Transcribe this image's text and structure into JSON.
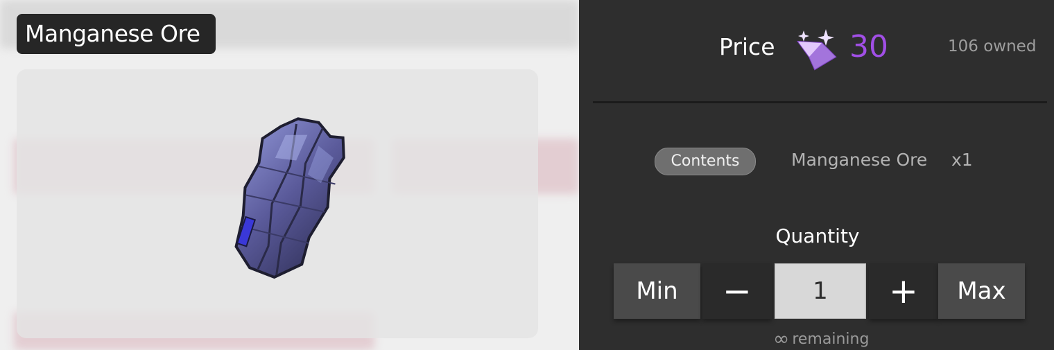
{
  "item": {
    "name": "Manganese Ore"
  },
  "price": {
    "label": "Price",
    "value": "30",
    "currency_icon": "purple-gem-icon",
    "currency_color": "#a14fe6",
    "owned": "106 owned"
  },
  "contents": {
    "tab_label": "Contents",
    "item_name": "Manganese Ore",
    "item_qty": "x1"
  },
  "quantity": {
    "title": "Quantity",
    "min_label": "Min",
    "minus_label": "−",
    "value": "1",
    "plus_label": "+",
    "max_label": "Max",
    "remaining_symbol": "∞",
    "remaining_label": "remaining"
  }
}
